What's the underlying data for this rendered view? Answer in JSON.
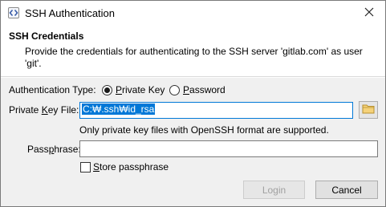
{
  "window": {
    "title": "SSH Authentication",
    "app_icon": "code-brackets-icon",
    "close_icon": "close-icon"
  },
  "header": {
    "title": "SSH Credentials",
    "description": "Provide the credentials for authenticating to the SSH server 'gitlab.com' as user 'git'."
  },
  "auth_type": {
    "label": "Authentication Type:",
    "options": [
      {
        "pre": "",
        "mnemonic": "P",
        "post": "rivate Key",
        "selected": true
      },
      {
        "pre": "",
        "mnemonic": "P",
        "post": "assword",
        "selected": false
      }
    ]
  },
  "private_key": {
    "label_pre": "Private ",
    "label_mnemonic": "K",
    "label_post": "ey File:",
    "value": "C:₩.ssh₩id_rsa",
    "browse_icon": "folder-icon",
    "hint": "Only private key files with OpenSSH format are supported."
  },
  "passphrase": {
    "label_pre": "Pass",
    "label_mnemonic": "p",
    "label_post": "hrase:",
    "value": ""
  },
  "store": {
    "pre": "",
    "mnemonic": "S",
    "post": "tore passphrase",
    "checked": false
  },
  "buttons": {
    "login": "Login",
    "cancel": "Cancel"
  },
  "colors": {
    "accent": "#0078d7",
    "body_bg": "#f0f0f0"
  }
}
